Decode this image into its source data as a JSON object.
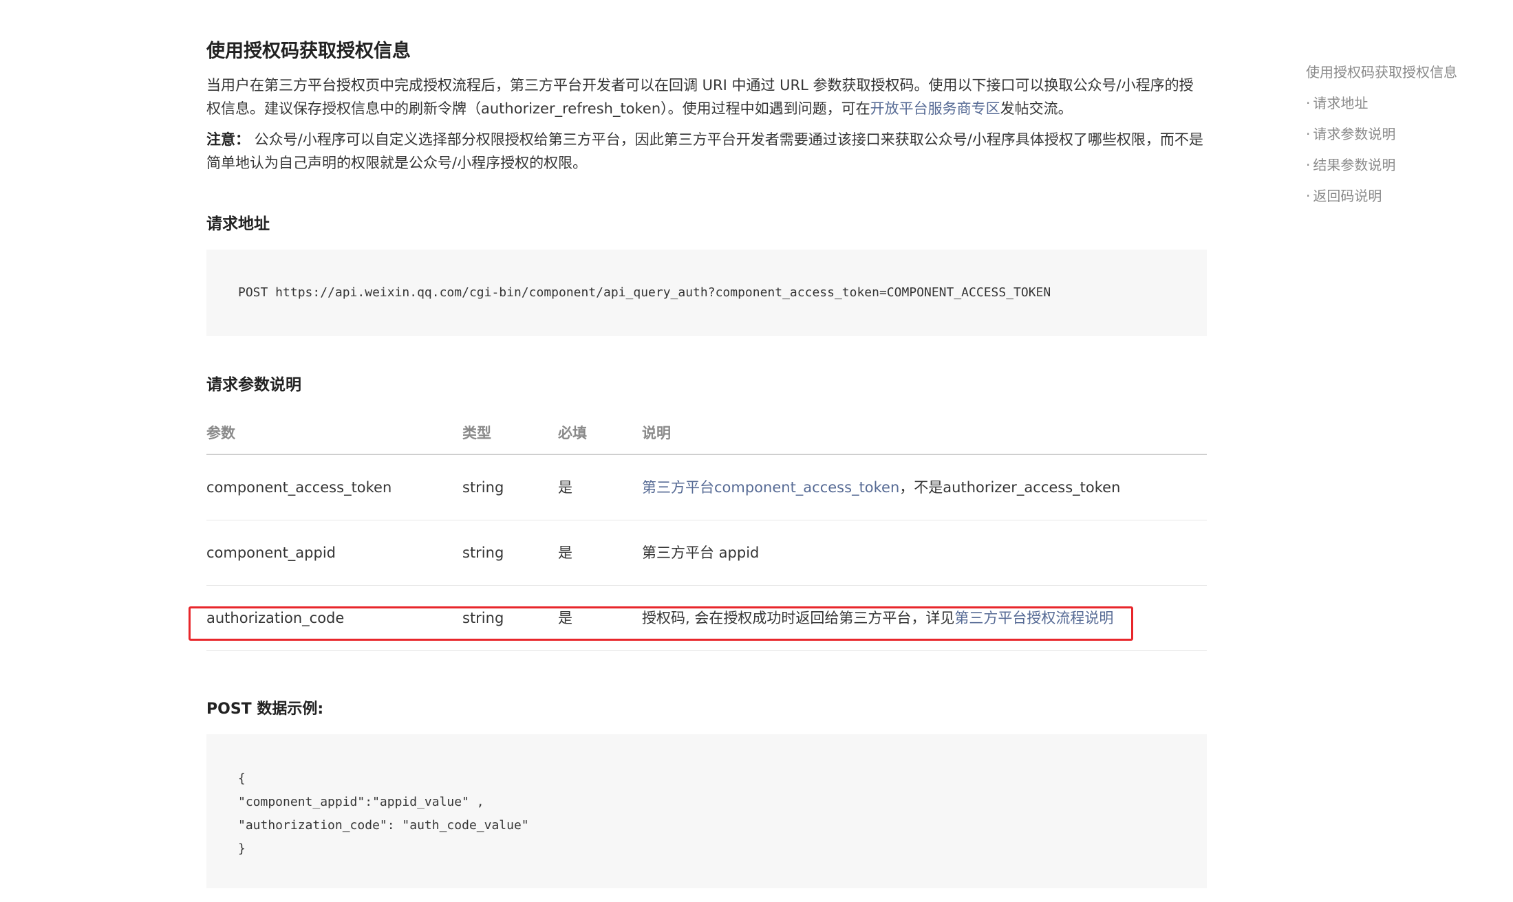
{
  "doc": {
    "title": "使用授权码获取授权信息",
    "intro": {
      "text_before_link": "当用户在第三方平台授权页中完成授权流程后，第三方平台开发者可以在回调 URI 中通过 URL 参数获取授权码。使用以下接口可以换取公众号/小程序的授权信息。建议保存授权信息中的刷新令牌（authorizer_refresh_token）。使用过程中如遇到问题，可在",
      "link": "开放平台服务商专区",
      "text_after_link": "发帖交流。"
    },
    "note": {
      "label": "注意：",
      "text": " 公众号/小程序可以自定义选择部分权限授权给第三方平台，因此第三方平台开发者需要通过该接口来获取公众号/小程序具体授权了哪些权限，而不是简单地认为自己声明的权限就是公众号/小程序授权的权限。"
    },
    "request_url": {
      "heading": "请求地址",
      "code": "POST https://api.weixin.qq.com/cgi-bin/component/api_query_auth?component_access_token=COMPONENT_ACCESS_TOKEN"
    },
    "params": {
      "heading": "请求参数说明",
      "columns": [
        "参数",
        "类型",
        "必填",
        "说明"
      ],
      "rows": [
        {
          "name": "component_access_token",
          "type": "string",
          "required": "是",
          "desc_link": "第三方平台component_access_token",
          "desc_text": "，不是authorizer_access_token"
        },
        {
          "name": "component_appid",
          "type": "string",
          "required": "是",
          "desc_link": "",
          "desc_text": "第三方平台 appid"
        },
        {
          "name": "authorization_code",
          "type": "string",
          "required": "是",
          "desc_text": "授权码, 会在授权成功时返回给第三方平台，详见",
          "desc_link": "第三方平台授权流程说明"
        }
      ]
    },
    "post_example": {
      "heading": "POST 数据示例:",
      "lines": [
        "{",
        "\"component_appid\":\"appid_value\" ,",
        "\"authorization_code\": \"auth_code_value\"",
        "}"
      ]
    }
  },
  "toc": {
    "items": [
      "使用授权码获取授权信息",
      "请求地址",
      "请求参数说明",
      "结果参数说明",
      "返回码说明"
    ],
    "bullet": "·"
  },
  "colors": {
    "link": "#576b95",
    "highlight": "#e8262b",
    "code_bg": "#f7f7f7"
  }
}
